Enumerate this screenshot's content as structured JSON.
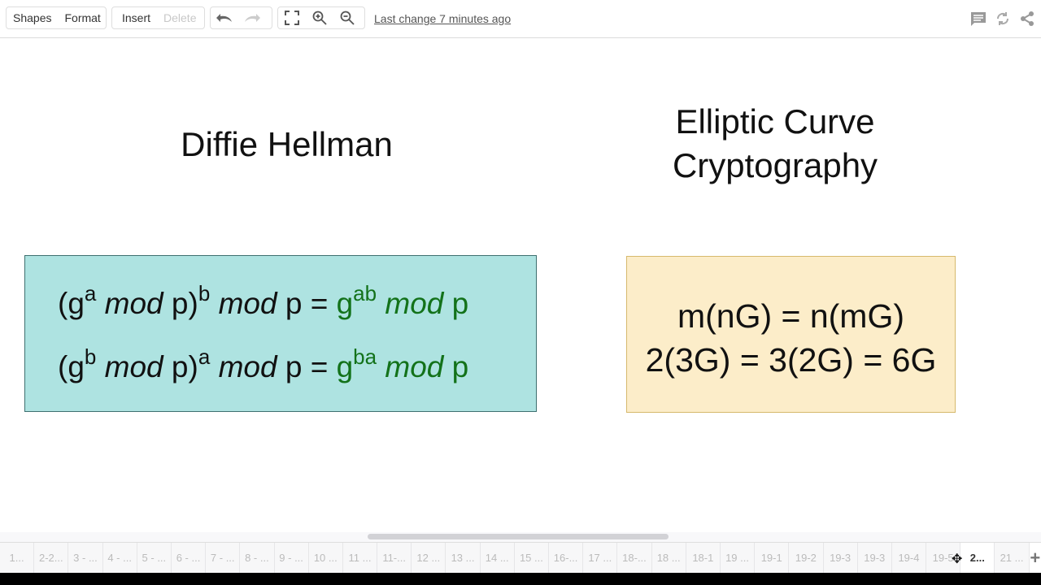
{
  "toolbar": {
    "shapes_label": "Shapes",
    "format_label": "Format",
    "insert_label": "Insert",
    "delete_label": "Delete",
    "last_change": "Last change 7 minutes ago",
    "icons": [
      "undo-icon",
      "redo-icon",
      "fullscreen-icon",
      "zoom-in-icon",
      "zoom-out-icon",
      "comment-icon",
      "sync-icon",
      "share-icon"
    ]
  },
  "canvas": {
    "left_title": "Diffie Hellman",
    "right_title_line1": "Elliptic Curve",
    "right_title_line2": "Cryptography",
    "dh_box": {
      "bg_color": "#aee3e1",
      "line1": {
        "open": "(g",
        "sup1": "a",
        "mod1": "mod",
        "p1": " p)",
        "sup2": "b",
        "mod2": "mod",
        "p2": " p = ",
        "rhs_g": "g",
        "rhs_sup": "ab",
        "rhs_mod": "mod",
        "rhs_p": " p"
      },
      "line2": {
        "open": "(g",
        "sup1": "b",
        "mod1": "mod",
        "p1": " p)",
        "sup2": "a",
        "mod2": "mod",
        "p2": " p = ",
        "rhs_g": "g",
        "rhs_sup": "ba",
        "rhs_mod": "mod",
        "rhs_p": " p"
      },
      "rhs_color": "#13721a"
    },
    "ecc_box": {
      "bg_color": "#fcedc9",
      "line1": "m(nG) = n(mG)",
      "line2": "2(3G) = 3(2G) = 6G"
    }
  },
  "tabs": [
    "1...",
    "2-2...",
    "3 - ...",
    "4 - ...",
    "5 - ...",
    "6 - ...",
    "7 - ...",
    "8 - ...",
    "9 - ...",
    "10 ...",
    "11 ...",
    "11-...",
    "12 ...",
    "13 ...",
    "14 ...",
    "15 ...",
    "16-...",
    "17 ...",
    "18-...",
    "18 ...",
    "18-1",
    "19 ...",
    "19-1",
    "19-2",
    "19-3",
    "19-3",
    "19-4",
    "19-5",
    "2...",
    "21 ..."
  ],
  "active_tab_index": 28,
  "add_tab_label": "+"
}
